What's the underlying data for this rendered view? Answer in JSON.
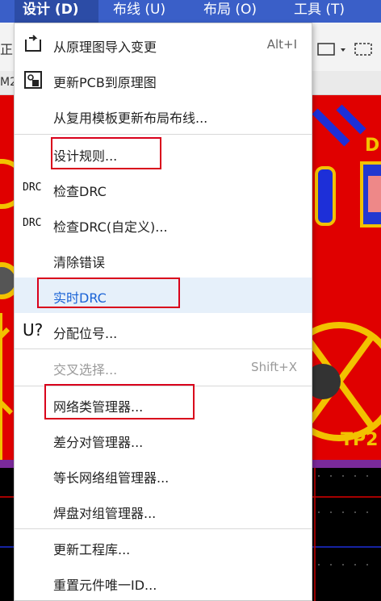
{
  "menubar": {
    "items": [
      {
        "label": "设计 (D)",
        "active": true
      },
      {
        "label": "布线 (U)",
        "active": false
      },
      {
        "label": "布局 (O)",
        "active": false
      },
      {
        "label": "工具 (T)",
        "active": false
      }
    ]
  },
  "toolbar": {
    "left_text": "正",
    "left_text2": "M2"
  },
  "pcb": {
    "label_d": "D",
    "label_tp": "TP2"
  },
  "menu": {
    "items": [
      {
        "label": "从原理图导入变更",
        "shortcut": "Alt+I",
        "icon": "import-from-schematic-icon"
      },
      {
        "label": "更新PCB到原理图",
        "icon": "update-schematic-icon"
      },
      {
        "label": "从复用模板更新布局布线..."
      },
      {
        "label": "设计规则..."
      },
      {
        "label": "检查DRC",
        "icon_text": "DRC"
      },
      {
        "label": "检查DRC(自定义)...",
        "icon_text": "DRC"
      },
      {
        "label": "清除错误"
      },
      {
        "label": "实时DRC"
      },
      {
        "label": "分配位号...",
        "icon_text": "U?"
      },
      {
        "label": "交叉选择...",
        "shortcut": "Shift+X",
        "disabled": true
      },
      {
        "label": "网络类管理器..."
      },
      {
        "label": "差分对管理器..."
      },
      {
        "label": "等长网络组管理器..."
      },
      {
        "label": "焊盘对组管理器..."
      },
      {
        "label": "更新工程库..."
      },
      {
        "label": "重置元件唯一ID..."
      }
    ]
  },
  "colors": {
    "menubar": "#3a5fc8",
    "highlight_text": "#1a63d6",
    "annotation_box": "#d9001b",
    "pcb_red": "#e00000"
  }
}
